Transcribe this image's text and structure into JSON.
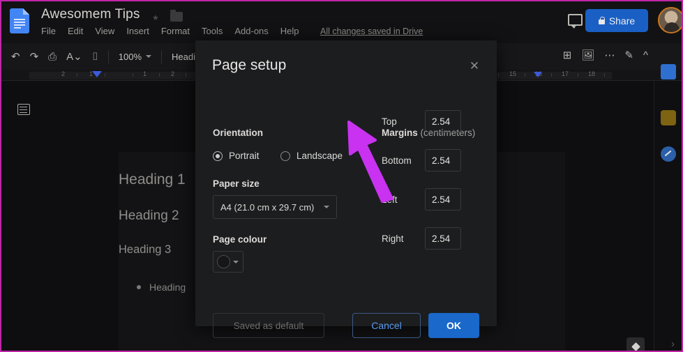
{
  "window": {
    "border_color": "#c026a8",
    "background": "#0e0e10"
  },
  "header": {
    "doc_title": "Awesomem Tips",
    "logo_icon": "docs-logo-icon",
    "star_icon": "star-icon",
    "folder_icon": "folder-icon",
    "menu_items": [
      {
        "label": "File"
      },
      {
        "label": "Edit"
      },
      {
        "label": "View"
      },
      {
        "label": "Insert"
      },
      {
        "label": "Format"
      },
      {
        "label": "Tools"
      },
      {
        "label": "Add-ons"
      },
      {
        "label": "Help"
      }
    ],
    "save_status": "All changes saved in Drive",
    "comment_icon": "comment-icon",
    "share_label": "Share",
    "share_lock_icon": "lock-icon",
    "share_color": "#1a5fc4",
    "avatar": "user-avatar"
  },
  "toolbar": {
    "undo_icon": "undo-icon",
    "redo_icon": "redo-icon",
    "print_icon": "print-icon",
    "spellcheck_icon": "spellcheck-icon",
    "paint_format_icon": "paint-format-icon",
    "zoom_value": "100%",
    "style_value": "Headi",
    "insert_comment_icon": "insert-comment-icon",
    "insert_image_icon": "insert-image-icon",
    "more_icon": "more-options-icon",
    "editing_mode_icon": "pencil-icon",
    "collapse_icon": "chevron-up-icon"
  },
  "ruler": {
    "left_numbers": [
      "2",
      "1",
      "1",
      "2"
    ],
    "right_numbers": [
      "15",
      "16",
      "17",
      "18"
    ],
    "indent_marker": "indent-marker-icon"
  },
  "outline": {
    "toggle_icon": "document-outline-icon"
  },
  "document": {
    "headings": [
      {
        "text": "Heading 1"
      },
      {
        "text": "Heading 2"
      },
      {
        "text": "Heading 3"
      },
      {
        "text": "Heading"
      }
    ]
  },
  "side_panel": {
    "apps": [
      {
        "name": "calendar-app-icon"
      },
      {
        "name": "keep-app-icon"
      },
      {
        "name": "tasks-app-icon"
      }
    ]
  },
  "explore": {
    "fab_icon": "explore-icon",
    "chevron_icon": "chevron-right-icon"
  },
  "dialog": {
    "title": "Page setup",
    "close_icon": "close-icon",
    "orientation": {
      "label": "Orientation",
      "options": [
        {
          "label": "Portrait",
          "selected": true
        },
        {
          "label": "Landscape",
          "selected": false
        }
      ]
    },
    "paper_size": {
      "label": "Paper size",
      "value": "A4 (21.0 cm x 29.7 cm)",
      "caret_icon": "chevron-down-icon"
    },
    "page_colour": {
      "label": "Page colour",
      "swatch_icon": "colour-swatch-icon",
      "caret_icon": "chevron-down-icon"
    },
    "margins": {
      "label": "Margins",
      "units": "(centimeters)",
      "fields": [
        {
          "name": "Top",
          "value": "2.54"
        },
        {
          "name": "Bottom",
          "value": "2.54"
        },
        {
          "name": "Left",
          "value": "2.54"
        },
        {
          "name": "Right",
          "value": "2.54"
        }
      ]
    },
    "buttons": {
      "saved_default": "Saved as default",
      "cancel": "Cancel",
      "ok": "OK",
      "ok_color": "#1a68c9"
    }
  },
  "annotation": {
    "arrow_color": "#c832f0",
    "arrow_icon": "pointer-arrow-annotation"
  }
}
